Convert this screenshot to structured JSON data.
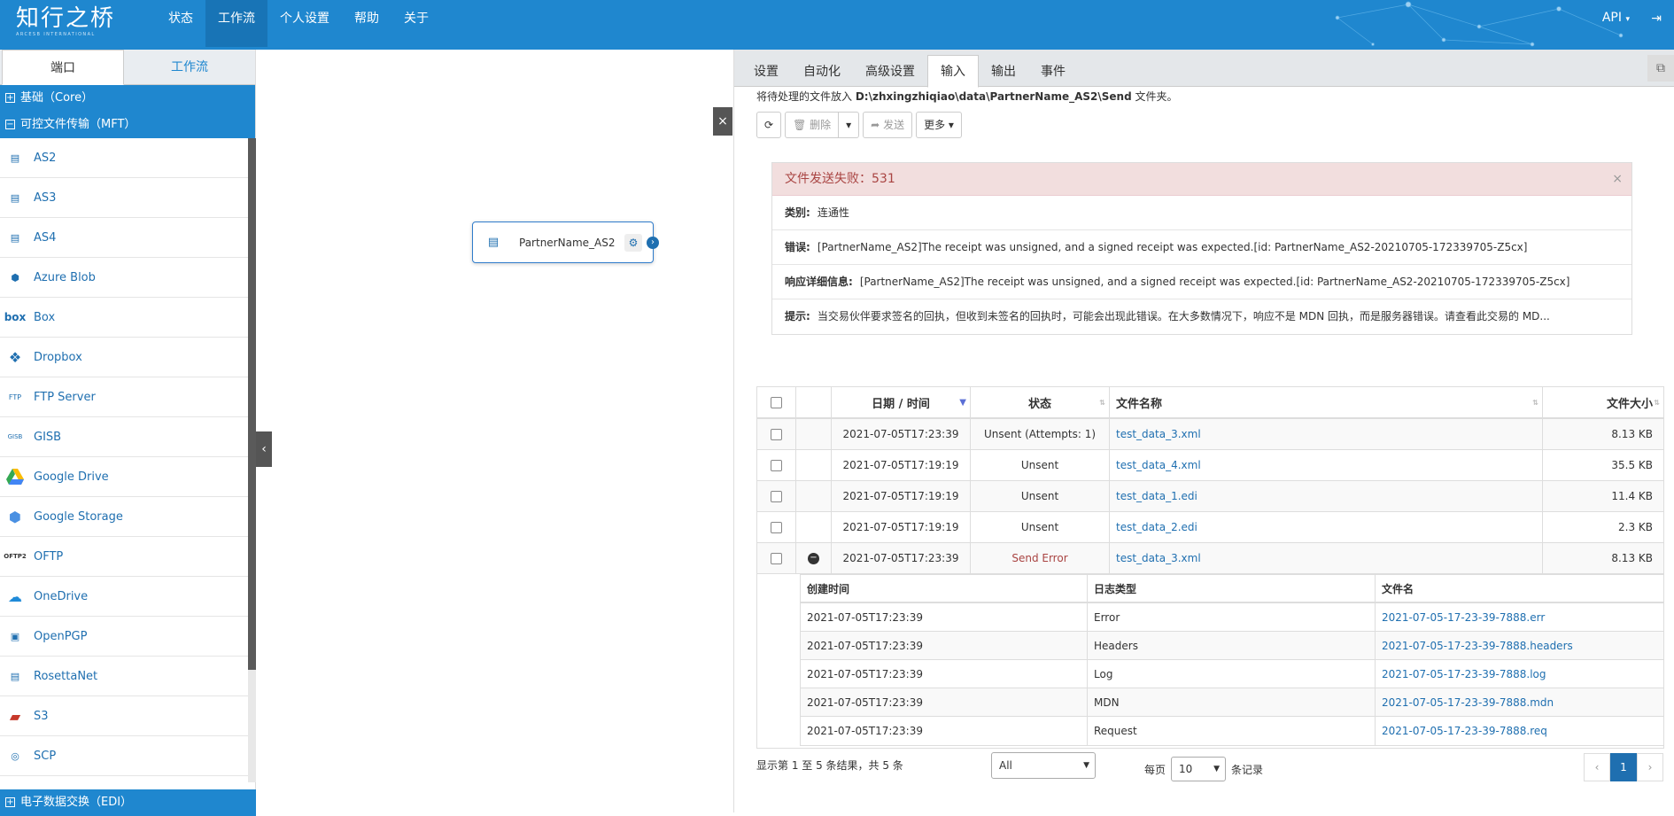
{
  "app": {
    "logo_cn": "知行之桥",
    "logo_en": "ARCESB INTERNATIONAL",
    "nav": [
      "状态",
      "工作流",
      "个人设置",
      "帮助",
      "关于"
    ],
    "api_label": "API"
  },
  "left": {
    "tabs": [
      "端口",
      "工作流"
    ],
    "categories": {
      "core": "基础（Core）",
      "mft": "可控文件传输（MFT）",
      "edi": "电子数据交换（EDI）"
    },
    "items": [
      {
        "label": "AS2",
        "icon": "as2-icon"
      },
      {
        "label": "AS3",
        "icon": "as3-icon"
      },
      {
        "label": "AS4",
        "icon": "as4-icon"
      },
      {
        "label": "Azure Blob",
        "icon": "azure-blob-icon"
      },
      {
        "label": "Box",
        "icon": "box-icon"
      },
      {
        "label": "Dropbox",
        "icon": "dropbox-icon"
      },
      {
        "label": "FTP Server",
        "icon": "ftp-server-icon"
      },
      {
        "label": "GISB",
        "icon": "gisb-icon"
      },
      {
        "label": "Google Drive",
        "icon": "google-drive-icon"
      },
      {
        "label": "Google Storage",
        "icon": "google-storage-icon"
      },
      {
        "label": "OFTP",
        "icon": "oftp-icon"
      },
      {
        "label": "OneDrive",
        "icon": "onedrive-icon"
      },
      {
        "label": "OpenPGP",
        "icon": "openpgp-icon"
      },
      {
        "label": "RosettaNet",
        "icon": "rosettanet-icon"
      },
      {
        "label": "S3",
        "icon": "s3-icon"
      },
      {
        "label": "SCP",
        "icon": "scp-icon"
      }
    ]
  },
  "canvas": {
    "node_label": "PartnerName_AS2"
  },
  "right": {
    "tabs": [
      "设置",
      "自动化",
      "高级设置",
      "输入",
      "输出",
      "事件"
    ],
    "active_tab": "输入",
    "info_prefix": "将待处理的文件放入",
    "info_path": "D:\\zhxingzhiqiao\\data\\PartnerName_AS2\\Send",
    "info_suffix": "文件夹。",
    "toolbar": {
      "delete": "删除",
      "send": "发送",
      "more": "更多"
    },
    "alert": {
      "title": "文件发送失败：531",
      "rows": [
        {
          "label": "类别:",
          "text": "连通性"
        },
        {
          "label": "错误:",
          "text": "[PartnerName_AS2]The receipt was unsigned, and a signed receipt was expected.[id: PartnerName_AS2-20210705-172339705-Z5cx]"
        },
        {
          "label": "响应详细信息:",
          "text": "[PartnerName_AS2]The receipt was unsigned, and a signed receipt was expected.[id: PartnerName_AS2-20210705-172339705-Z5cx]"
        },
        {
          "label": "提示:",
          "text": "当交易伙伴要求签名的回执，但收到未签名的回执时，可能会出现此错误。在大多数情况下，响应不是 MDN 回执，而是服务器错误。请查看此交易的 MD..."
        }
      ]
    },
    "table": {
      "headers": [
        "日期 / 时间",
        "状态",
        "文件名称",
        "文件大小"
      ],
      "rows": [
        {
          "date": "2021-07-05T17:23:39",
          "status": "Unsent (Attempts: 1)",
          "file": "test_data_3.xml",
          "size": "8.13 KB"
        },
        {
          "date": "2021-07-05T17:19:19",
          "status": "Unsent",
          "file": "test_data_4.xml",
          "size": "35.5 KB"
        },
        {
          "date": "2021-07-05T17:19:19",
          "status": "Unsent",
          "file": "test_data_1.edi",
          "size": "11.4 KB"
        },
        {
          "date": "2021-07-05T17:19:19",
          "status": "Unsent",
          "file": "test_data_2.edi",
          "size": "2.3 KB"
        },
        {
          "date": "2021-07-05T17:23:39",
          "status": "Send Error",
          "file": "test_data_3.xml",
          "size": "8.13 KB"
        }
      ],
      "log_headers": [
        "创建时间",
        "日志类型",
        "文件名"
      ],
      "logs": [
        {
          "time": "2021-07-05T17:23:39",
          "type": "Error",
          "file": "2021-07-05-17-23-39-7888.err"
        },
        {
          "time": "2021-07-05T17:23:39",
          "type": "Headers",
          "file": "2021-07-05-17-23-39-7888.headers"
        },
        {
          "time": "2021-07-05T17:23:39",
          "type": "Log",
          "file": "2021-07-05-17-23-39-7888.log"
        },
        {
          "time": "2021-07-05T17:23:39",
          "type": "MDN",
          "file": "2021-07-05-17-23-39-7888.mdn"
        },
        {
          "time": "2021-07-05T17:23:39",
          "type": "Request",
          "file": "2021-07-05-17-23-39-7888.req"
        }
      ]
    },
    "footer": {
      "summary": "显示第 1 至 5 条结果，共 5 条",
      "filter": "All",
      "per_page_prefix": "每页",
      "per_page": "10",
      "per_page_suffix": "条记录",
      "page": "1"
    }
  }
}
